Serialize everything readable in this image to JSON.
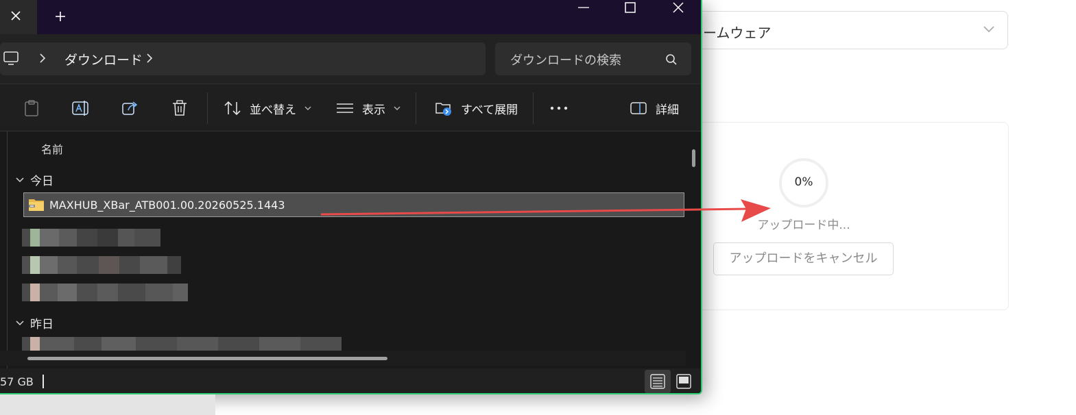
{
  "web": {
    "select_value": "ームウェア",
    "progress_percent": "0%",
    "progress_value": 0,
    "upload_status": "アップロード中...",
    "cancel_label": "アップロードをキャンセル"
  },
  "explorer": {
    "tab_new_label": "+",
    "address": {
      "folder": "ダウンロード"
    },
    "search": {
      "placeholder": "ダウンロードの検索"
    },
    "toolbar": {
      "sort_label": "並べ替え",
      "view_label": "表示",
      "expand_label": "すべて展開",
      "details_label": "詳細"
    },
    "list": {
      "column_name": "名前",
      "groups": [
        {
          "label": "今日"
        },
        {
          "label": "昨日"
        }
      ],
      "selected_file": "MAXHUB_XBar_ATB001.00.20260525.1443"
    },
    "status": {
      "text": "57 GB"
    }
  },
  "colors": {
    "accent_border": "#2ecc71",
    "arrow": "#e84a4a",
    "titlebar": "#1b0f2e"
  }
}
